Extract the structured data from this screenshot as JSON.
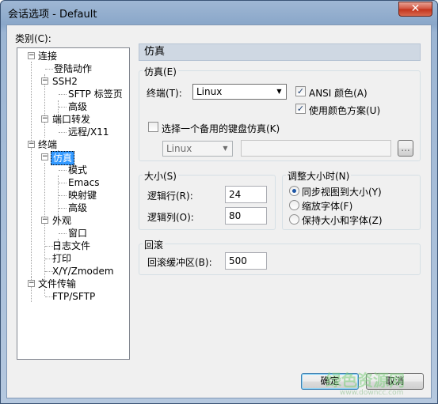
{
  "window": {
    "title": "会话选项 - Default",
    "close_label": "✕"
  },
  "category_label": "类别(C):",
  "tree": {
    "connection": "连接",
    "login_actions": "登陆动作",
    "ssh2": "SSH2",
    "sftp_tab": "SFTP 标签页",
    "advanced_ssh": "高级",
    "port_forward": "端口转发",
    "remote_x11": "远程/X11",
    "terminal": "终端",
    "emulation": "仿真",
    "modes": "模式",
    "emacs": "Emacs",
    "mapped_keys": "映射键",
    "advanced_term": "高级",
    "appearance": "外观",
    "window": "窗口",
    "log_file": "日志文件",
    "print": "打印",
    "xyzmodem": "X/Y/Zmodem",
    "file_transfer": "文件传输",
    "ftp_sftp": "FTP/SFTP"
  },
  "panel": {
    "header": "仿真",
    "emulation_group": {
      "label": "仿真(E)",
      "terminal_label": "终端(T):",
      "terminal_value": "Linux",
      "ansi_color_label": "ANSI 颜色(A)",
      "ansi_color_checked": true,
      "color_scheme_label": "使用颜色方案(U)",
      "color_scheme_checked": true,
      "alt_keyboard_label": "选择一个备用的键盘仿真(K)",
      "alt_keyboard_checked": false,
      "alt_keyboard_value": "Linux",
      "browse_label": "..."
    },
    "size_group": {
      "label": "大小(S)",
      "rows_label": "逻辑行(R):",
      "rows_value": "24",
      "cols_label": "逻辑列(O):",
      "cols_value": "80"
    },
    "resize_group": {
      "label": "调整大小时(N)",
      "options": [
        "同步视图到大小(Y)",
        "缩放字体(F)",
        "保持大小和字体(Z)"
      ],
      "selected": 0
    },
    "scrollback_group": {
      "label": "回滚",
      "buffer_label": "回滚缓冲区(B):",
      "buffer_value": "500"
    }
  },
  "buttons": {
    "ok": "确定",
    "cancel": "取消"
  },
  "watermark": {
    "text": "绿色资源网",
    "url": "www.downcc.com"
  }
}
